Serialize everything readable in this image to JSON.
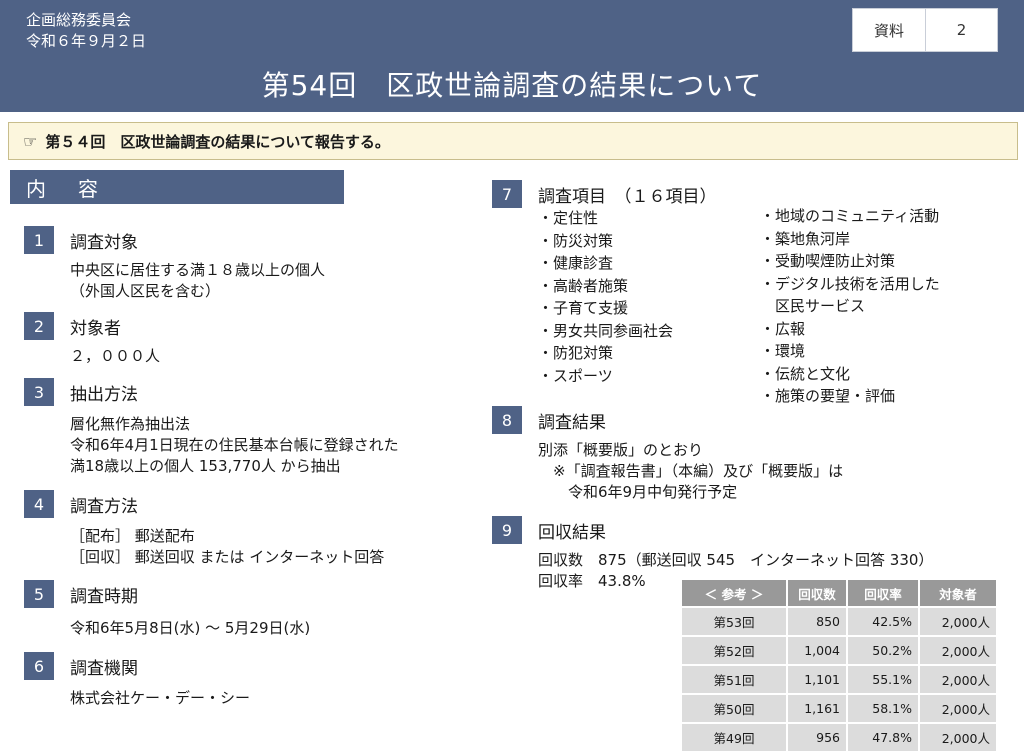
{
  "header": {
    "org_line1": "企画総務委員会",
    "org_line2": "令和６年９月２日",
    "badge_label": "資料",
    "badge_number": "2",
    "title": "第54回　区政世論調査の結果について"
  },
  "summary": {
    "icon": "pointing-hand-icon",
    "text": "第５４回　区政世論調査の結果について報告する。"
  },
  "section_title": "内　容",
  "items": {
    "i1": {
      "num": "1",
      "title": "調査対象",
      "lines": [
        "中央区に居住する満１８歳以上の個人",
        "（外国人区民を含む）"
      ]
    },
    "i2": {
      "num": "2",
      "title": "対象者",
      "lines": [
        "２，０００人"
      ]
    },
    "i3": {
      "num": "3",
      "title": "抽出方法",
      "lines": [
        "層化無作為抽出法",
        "令和6年4月1日現在の住民基本台帳に登録された",
        "満18歳以上の個人 153,770人 から抽出"
      ]
    },
    "i4": {
      "num": "4",
      "title": "調査方法",
      "lines": [
        "［配布］ 郵送配布",
        "［回収］ 郵送回収 または インターネット回答"
      ]
    },
    "i5": {
      "num": "5",
      "title": "調査時期",
      "lines": [
        "令和6年5月8日(水) ～ 5月29日(水)"
      ]
    },
    "i6": {
      "num": "6",
      "title": "調査機関",
      "lines": [
        "株式会社ケー・デー・シー"
      ]
    },
    "i7": {
      "num": "7",
      "title": "調査項目　（１６項目）",
      "col1": [
        "・定住性",
        "・防災対策",
        "・健康診査",
        "・高齢者施策",
        "・子育て支援",
        "・男女共同参画社会",
        "・防犯対策",
        "・スポーツ"
      ],
      "col2": [
        "・地域のコミュニティ活動",
        "・築地魚河岸",
        "・受動喫煙防止対策",
        "・デジタル技術を活用した",
        "　区民サービス",
        "・広報",
        "・環境",
        "・伝統と文化",
        "・施策の要望・評価"
      ]
    },
    "i8": {
      "num": "8",
      "title": "調査結果",
      "lines": [
        "別添「概要版」のとおり",
        "　※「調査報告書」（本編）及び「概要版」は",
        "　　令和6年9月中旬発行予定"
      ]
    },
    "i9": {
      "num": "9",
      "title": "回収結果",
      "lines": [
        "回収数　875（郵送回収 545　インターネット回答 330）",
        "回収率　43.8%"
      ]
    }
  },
  "reference_table": {
    "headers": [
      "＜ 参考 ＞",
      "回収数",
      "回収率",
      "対象者"
    ],
    "rows": [
      [
        "第53回",
        "850",
        "42.5%",
        "2,000人"
      ],
      [
        "第52回",
        "1,004",
        "50.2%",
        "2,000人"
      ],
      [
        "第51回",
        "1,101",
        "55.1%",
        "2,000人"
      ],
      [
        "第50回",
        "1,161",
        "58.1%",
        "2,000人"
      ],
      [
        "第49回",
        "956",
        "47.8%",
        "2,000人"
      ]
    ]
  }
}
